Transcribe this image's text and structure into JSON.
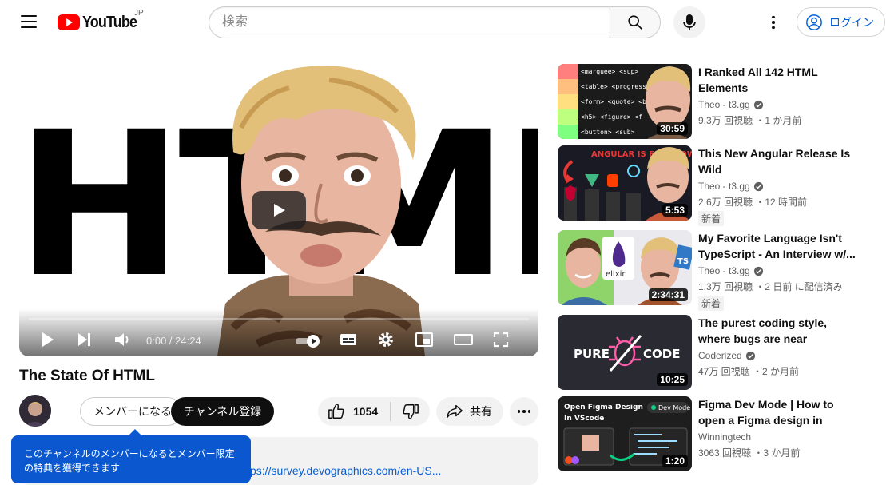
{
  "header": {
    "logo_text": "YouTube",
    "region": "JP",
    "search_placeholder": "検索",
    "login_label": "ログイン"
  },
  "player": {
    "thumbnail_text": "HTML",
    "time_current": "0:00",
    "time_total": "24:24",
    "progress": 0
  },
  "video": {
    "title": "The State Of HTML",
    "member_label": "メンバーになる",
    "subscribe_label": "チャンネル登録",
    "like_count": "1054",
    "share_label": "共有",
    "description_link": "ps://survey.devographics.com/en-US..."
  },
  "tooltip": {
    "line1": "このチャンネルのメンバーになるとメンバー限定",
    "line2": "の特典を獲得できます"
  },
  "recommendations": [
    {
      "title": "I Ranked All 142 HTML Elements",
      "channel": "Theo - t3.gg",
      "verified": true,
      "meta": "9.3万 回視聴 ・1 か月前",
      "badge": "",
      "duration": "30:59"
    },
    {
      "title": "This New Angular Release Is Wild",
      "channel": "Theo - t3.gg",
      "verified": true,
      "meta": "2.6万 回視聴 ・12 時間前",
      "badge": "新着",
      "duration": "5:53"
    },
    {
      "title": "My Favorite Language Isn't TypeScript - An Interview w/...",
      "channel": "Theo - t3.gg",
      "verified": true,
      "meta": "1.3万 回視聴 ・2 日前 に配信済み",
      "badge": "新着",
      "duration": "2:34:31"
    },
    {
      "title": "The purest coding style, where bugs are near impossible",
      "channel": "Coderized",
      "verified": true,
      "meta": "47万 回視聴 ・2 か月前",
      "badge": "",
      "duration": "10:25"
    },
    {
      "title": "Figma Dev Mode | How to open a Figma design in VScode.",
      "channel": "Winningtech",
      "verified": false,
      "meta": "3063 回視聴 ・3 か月前",
      "badge": "",
      "duration": "1:20"
    }
  ],
  "thumb_text": {
    "tier_tags": [
      "<marquee> <sup>",
      "<table> <progress>",
      "<form> <quote> <b>",
      "<h5> <figure> <f",
      "<button> <sub>"
    ],
    "angular_caption": "ANGULAR IS FAST NOW??",
    "elixir_label": "elixir",
    "ts_label": "TS",
    "pure_word": "PURE",
    "code_word": "CODE",
    "figma_caption_1": "Open Figma Design",
    "figma_caption_2": "In VScode",
    "dev_mode_label": "Dev Mode"
  }
}
